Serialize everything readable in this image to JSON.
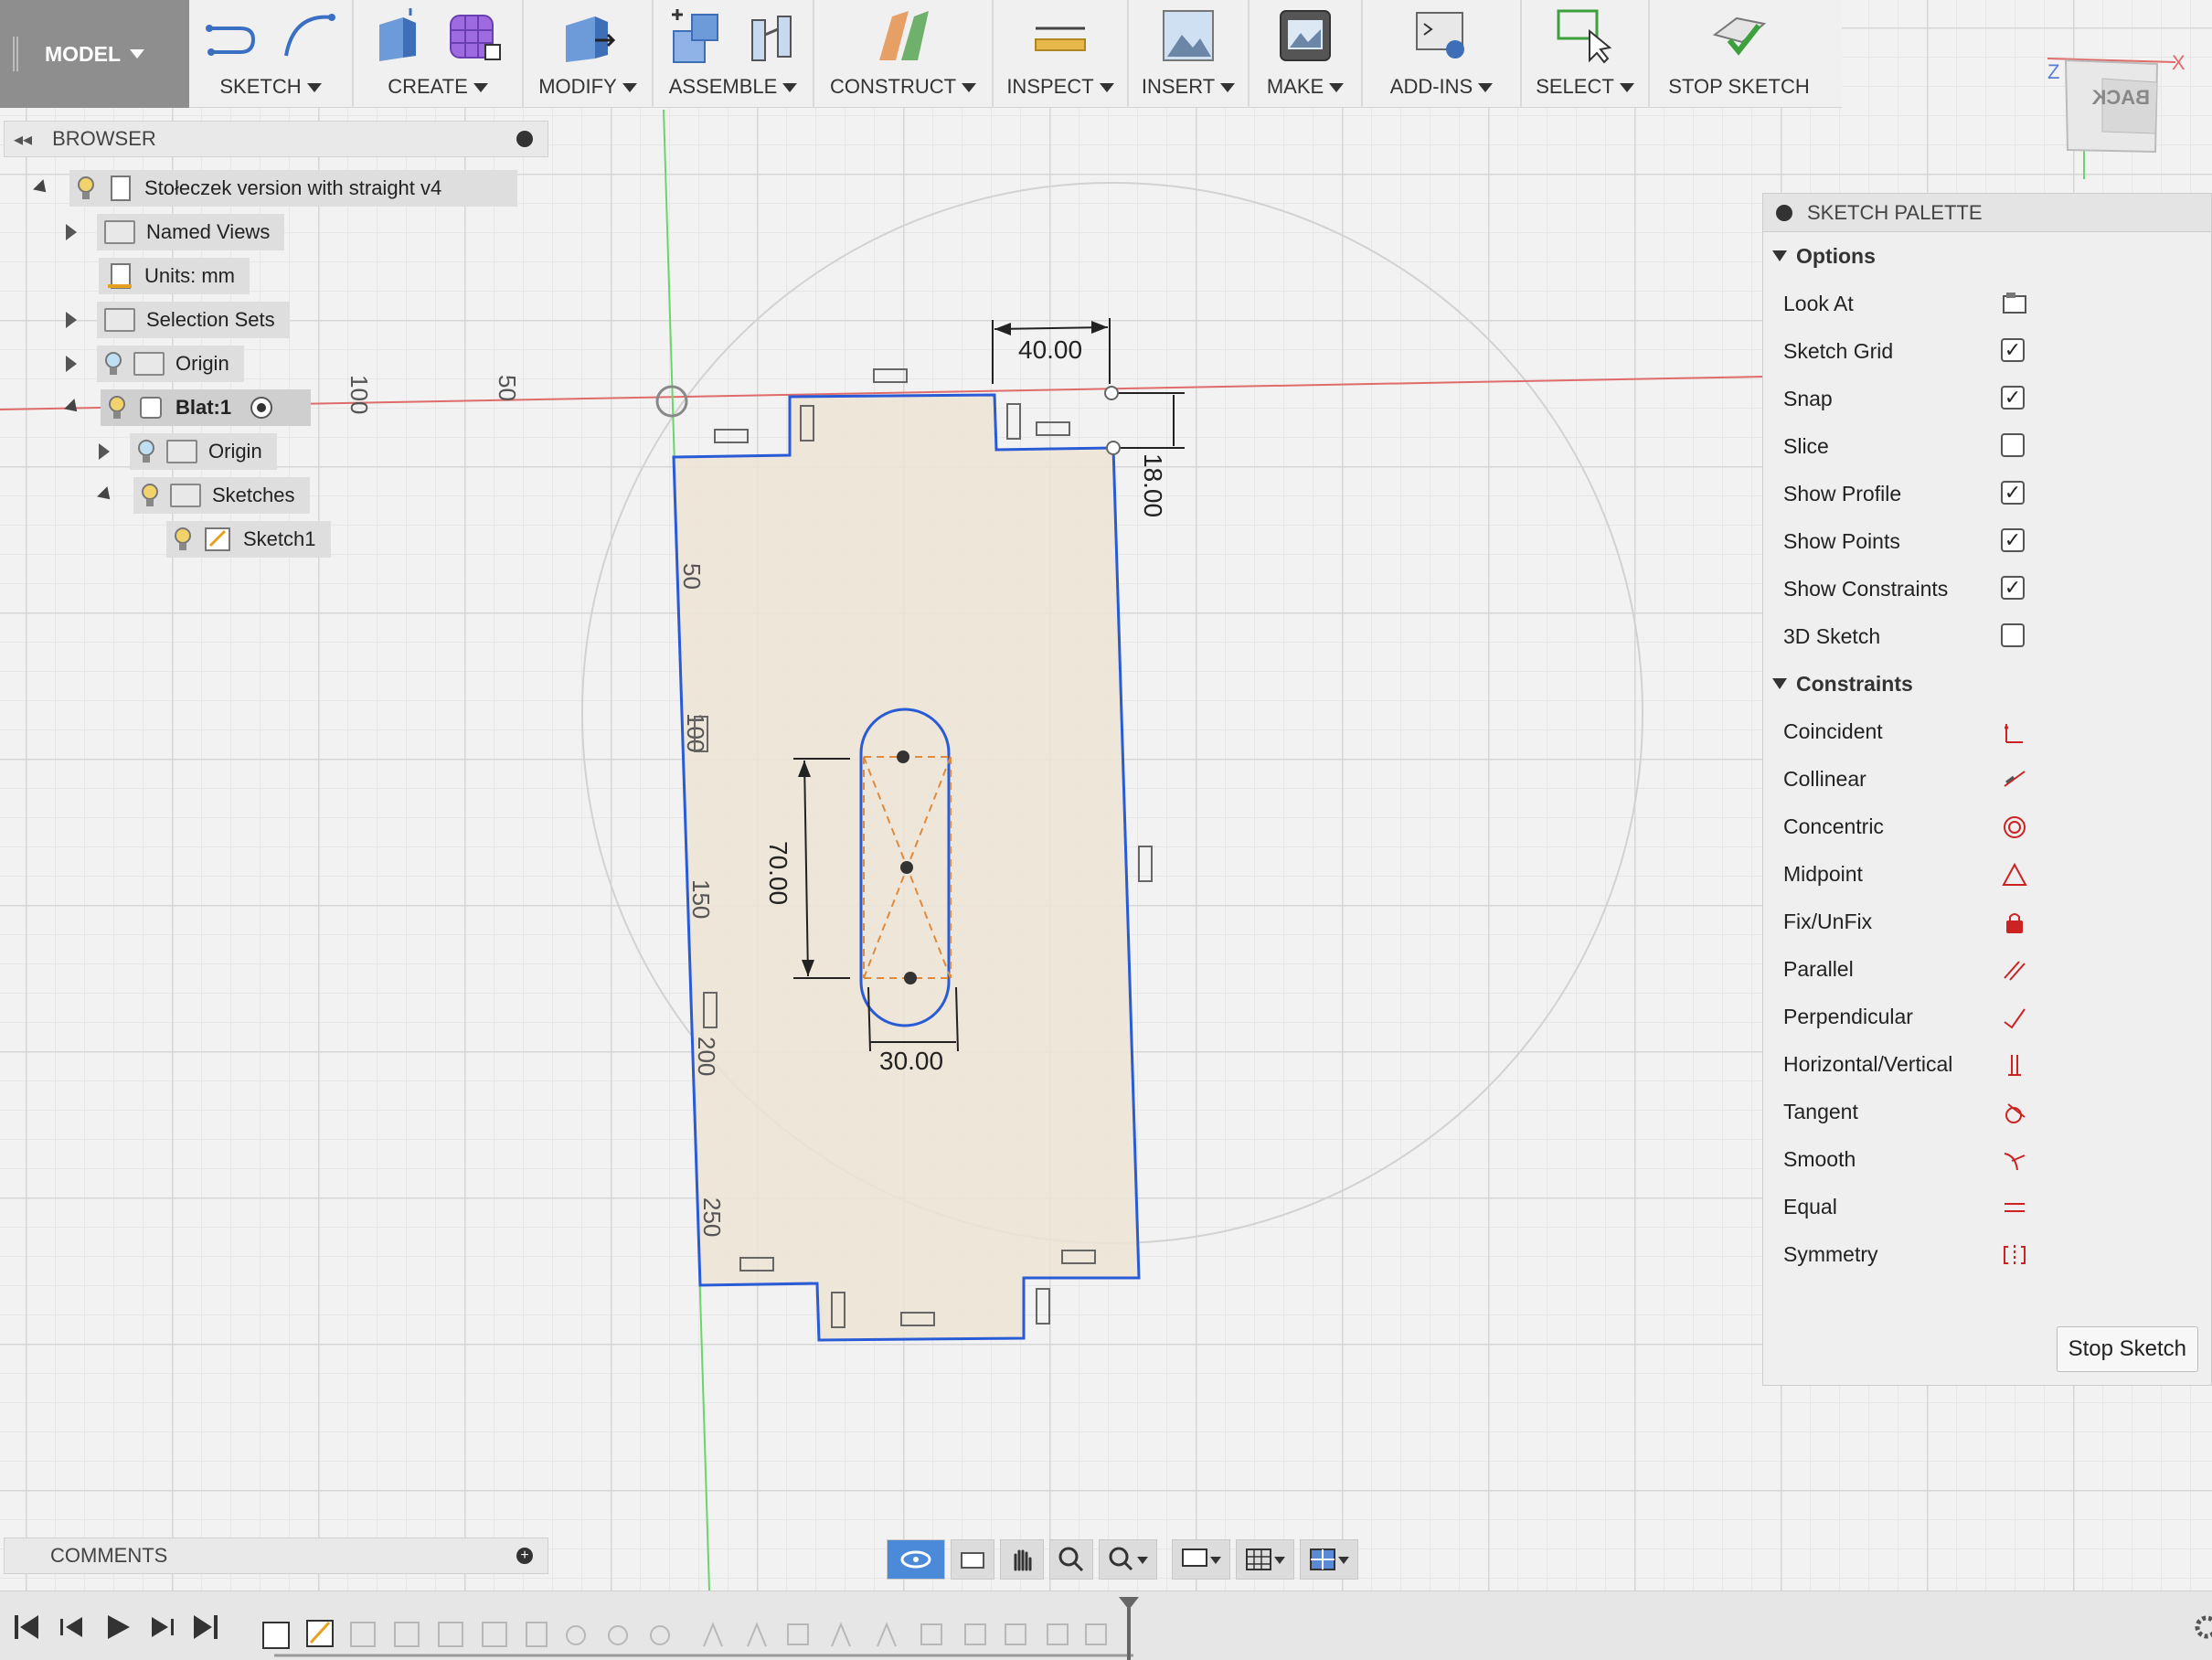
{
  "toolbar": {
    "mode_label": "MODEL",
    "groups": [
      {
        "label": "SKETCH"
      },
      {
        "label": "CREATE"
      },
      {
        "label": "MODIFY"
      },
      {
        "label": "ASSEMBLE"
      },
      {
        "label": "CONSTRUCT"
      },
      {
        "label": "INSPECT"
      },
      {
        "label": "INSERT"
      },
      {
        "label": "MAKE"
      },
      {
        "label": "ADD-INS"
      },
      {
        "label": "SELECT"
      },
      {
        "label": "STOP SKETCH"
      }
    ]
  },
  "browser": {
    "title": "BROWSER",
    "root": "Stołeczek version with straight v4",
    "named_views": "Named Views",
    "units": "Units: mm",
    "selection_sets": "Selection Sets",
    "origin": "Origin",
    "component": "Blat:1",
    "comp_origin": "Origin",
    "sketches": "Sketches",
    "sketch1": "Sketch1"
  },
  "palette": {
    "title": "SKETCH PALETTE",
    "options_label": "Options",
    "options": [
      {
        "label": "Look At",
        "type": "button"
      },
      {
        "label": "Sketch Grid",
        "type": "checkbox",
        "checked": true
      },
      {
        "label": "Snap",
        "type": "checkbox",
        "checked": true
      },
      {
        "label": "Slice",
        "type": "checkbox",
        "checked": false
      },
      {
        "label": "Show Profile",
        "type": "checkbox",
        "checked": true
      },
      {
        "label": "Show Points",
        "type": "checkbox",
        "checked": true
      },
      {
        "label": "Show Constraints",
        "type": "checkbox",
        "checked": true
      },
      {
        "label": "3D Sketch",
        "type": "checkbox",
        "checked": false
      }
    ],
    "constraints_label": "Constraints",
    "constraints": [
      {
        "label": "Coincident",
        "icon": "coincident-icon"
      },
      {
        "label": "Collinear",
        "icon": "collinear-icon"
      },
      {
        "label": "Concentric",
        "icon": "concentric-icon"
      },
      {
        "label": "Midpoint",
        "icon": "midpoint-icon"
      },
      {
        "label": "Fix/UnFix",
        "icon": "lock-icon"
      },
      {
        "label": "Parallel",
        "icon": "parallel-icon"
      },
      {
        "label": "Perpendicular",
        "icon": "perpendicular-icon"
      },
      {
        "label": "Horizontal/Vertical",
        "icon": "horizontal-vertical-icon"
      },
      {
        "label": "Tangent",
        "icon": "tangent-icon"
      },
      {
        "label": "Smooth",
        "icon": "smooth-icon"
      },
      {
        "label": "Equal",
        "icon": "equal-icon"
      },
      {
        "label": "Symmetry",
        "icon": "symmetry-icon"
      }
    ],
    "stop_button": "Stop Sketch",
    "accent": "#cc2222"
  },
  "comments": {
    "title": "COMMENTS"
  },
  "sketch": {
    "dim_top_width": "40.00",
    "dim_notch_depth": "18.00",
    "dim_slot_length": "70.00",
    "dim_slot_width": "30.00",
    "ruler_top": [
      "100",
      "50"
    ],
    "ruler_vertical": [
      "50",
      "100",
      "150",
      "200",
      "250"
    ],
    "profile_color": "#efe4d6",
    "edge_color": "#2a5bd7"
  },
  "viewcube": {
    "face": "BACK"
  }
}
